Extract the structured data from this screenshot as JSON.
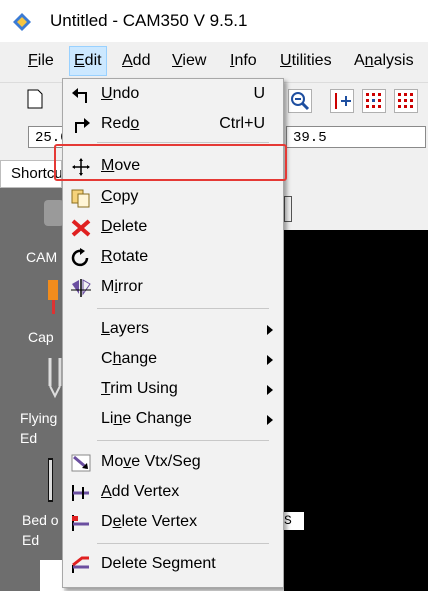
{
  "window": {
    "title": "Untitled - CAM350 V 9.5.1"
  },
  "menubar": [
    {
      "label": "File",
      "key": "F",
      "rest": "ile"
    },
    {
      "label": "Edit",
      "key": "E",
      "rest": "dit"
    },
    {
      "label": "Add",
      "key": "A",
      "rest": "dd"
    },
    {
      "label": "View",
      "key": "V",
      "rest": "iew"
    },
    {
      "label": "Info",
      "key": "I",
      "rest": "nfo"
    },
    {
      "label": "Utilities",
      "key": "U",
      "rest": "tilities"
    },
    {
      "label": "Analysis",
      "key": "n",
      "pre": "A",
      "rest": "alysis"
    }
  ],
  "coords": {
    "x": "25.0",
    "y": "39.5"
  },
  "left_panel": {
    "title": "Shortcuts",
    "tools": [
      {
        "label": "CAM"
      },
      {
        "label": "Cap"
      },
      {
        "label": "Flying\nEd"
      },
      {
        "label": "Bed o\nEd"
      }
    ]
  },
  "canvas": {
    "label": "S"
  },
  "edit_menu": {
    "items": [
      {
        "pre": "",
        "key": "U",
        "post": "ndo",
        "shortcut": "U",
        "icon": "undo-icon"
      },
      {
        "pre": "Red",
        "key": "o",
        "post": "",
        "shortcut": "Ctrl+U",
        "icon": "redo-icon"
      },
      {
        "pre": "",
        "key": "M",
        "post": "ove",
        "shortcut": "",
        "icon": "move-icon"
      },
      {
        "pre": "",
        "key": "C",
        "post": "opy",
        "shortcut": "",
        "icon": "copy-icon"
      },
      {
        "pre": "",
        "key": "D",
        "post": "elete",
        "shortcut": "",
        "icon": "delete-icon"
      },
      {
        "pre": "",
        "key": "R",
        "post": "otate",
        "shortcut": "",
        "icon": "rotate-icon"
      },
      {
        "pre": "M",
        "key": "i",
        "post": "rror",
        "shortcut": "",
        "icon": "mirror-icon"
      },
      {
        "pre": "",
        "key": "L",
        "post": "ayers",
        "submenu": true
      },
      {
        "pre": "C",
        "key": "h",
        "post": "ange",
        "submenu": true
      },
      {
        "pre": "",
        "key": "T",
        "post": "rim Using",
        "submenu": true
      },
      {
        "pre": "Li",
        "key": "n",
        "post": "e Change",
        "submenu": true
      },
      {
        "pre": "Mo",
        "key": "v",
        "post": "e Vtx/Seg",
        "icon": "move-vertex-icon"
      },
      {
        "pre": "",
        "key": "A",
        "post": "dd Vertex",
        "icon": "add-vertex-icon"
      },
      {
        "pre": "D",
        "key": "e",
        "post": "lete Vertex",
        "icon": "delete-vertex-icon"
      },
      {
        "pre": "Delete Se",
        "key": "g",
        "post": "ment",
        "icon": "delete-segment-icon"
      }
    ]
  },
  "colors": {
    "highlight": "#e53935",
    "menubar_active": "#cce8ff",
    "canvas": "#000000"
  }
}
